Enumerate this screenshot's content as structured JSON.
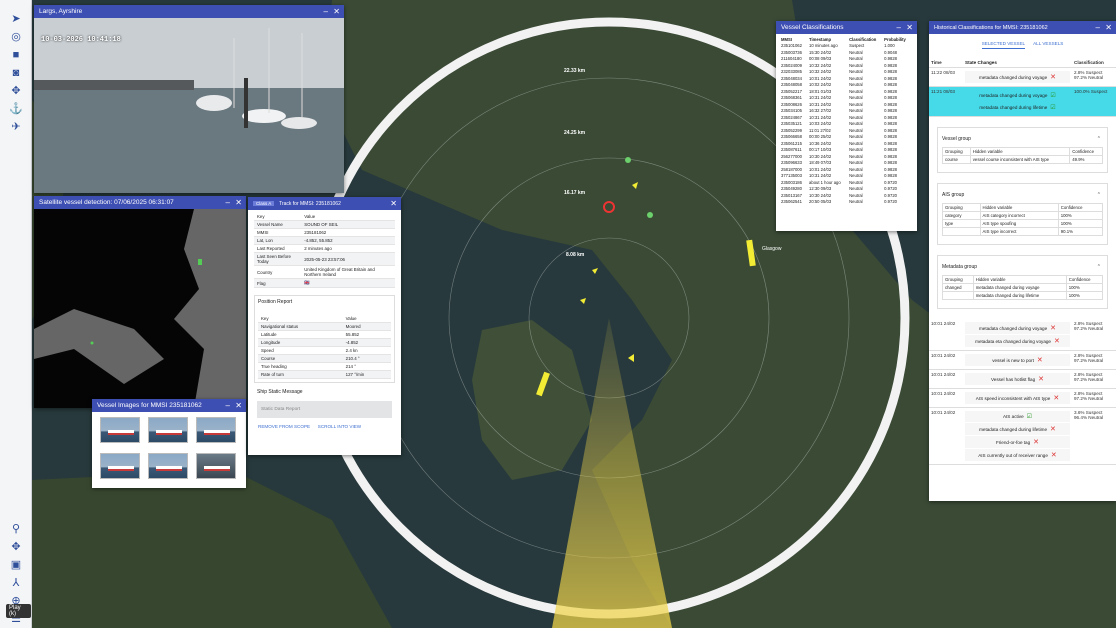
{
  "sidebar": {
    "tooltip": "Play (k)",
    "top_icons": [
      "navigation-icon",
      "radar-icon",
      "video-icon",
      "camera-icon",
      "satellite-icon",
      "anchor-icon",
      "satellite-dish-icon"
    ],
    "bottom_icons": [
      "pin-icon",
      "satellite-small-icon",
      "linkedin-icon",
      "route-icon",
      "zoom-icon",
      "list-icon"
    ]
  },
  "map": {
    "city_label": "Glasgow",
    "range_labels": [
      "22.33 km",
      "24.25 km",
      "16.17 km",
      "8.08 km"
    ],
    "ring_colors": {
      "sweep": "#f0d44a",
      "vessel": "#f0e13a",
      "ring": "#ffffff"
    }
  },
  "camera": {
    "title": "Largs, Ayrshire",
    "timestamp": "10-03-2026 10:41:18"
  },
  "satellite": {
    "title": "Satellite vessel detection: 07/06/2025 06:31:07"
  },
  "images": {
    "title": "Vessel Images for MMSI 235181062"
  },
  "track": {
    "badge": "Class A",
    "title": "Track for MMSI: 235181062",
    "head": {
      "key": "Key",
      "value": "Value"
    },
    "rows": [
      [
        "Vessel Name",
        "SOUND OF SEIL"
      ],
      [
        "MMSI",
        "235181062"
      ],
      [
        "Lat, Lon",
        "-4.852, 55.852"
      ],
      [
        "Last Reported",
        "2 minutes ago"
      ],
      [
        "Last Seen Before Today",
        "2025-05-23 23:57:06"
      ],
      [
        "Country",
        "United Kingdom of Great Britain and Northern Ireland"
      ],
      [
        "Flag",
        "🇬🇧"
      ]
    ],
    "position_title": "Position Report",
    "position_rows": [
      [
        "Navigational status",
        "Moored"
      ],
      [
        "Latitude",
        "55.852"
      ],
      [
        "Longitude",
        "-4.852"
      ],
      [
        "Speed",
        "2.4 kn"
      ],
      [
        "Course",
        "210.4 °"
      ],
      [
        "True heading",
        "214 °"
      ],
      [
        "Rate of turn",
        "127 °/min"
      ]
    ],
    "static_title": "Ship Static Message",
    "static_button": "Static Data Report",
    "remove": "REMOVE FROM SCOPE",
    "scroll": "SCROLL INTO VIEW"
  },
  "classifications": {
    "title": "Vessel Classifications",
    "headers": [
      "MMSI",
      "Timestamp",
      "Classification",
      "Probability"
    ],
    "rows": [
      [
        "235101062",
        "10 minutes ago",
        "Suspect",
        "1.000"
      ],
      [
        "235003736",
        "15:30 24/02",
        "Neutral",
        "0.9048"
      ],
      [
        "211604180",
        "00:08 09/03",
        "Neutral",
        "0.9828"
      ],
      [
        "235024009",
        "10:32 24/02",
        "Neutral",
        "0.9828"
      ],
      [
        "232033085",
        "10:32 24/02",
        "Neutral",
        "0.9828"
      ],
      [
        "235048034",
        "10:01 24/02",
        "Neutral",
        "0.9828"
      ],
      [
        "235048058",
        "10:02 24/02",
        "Neutral",
        "0.9828"
      ],
      [
        "235052217",
        "18:01 01/03",
        "Neutral",
        "0.9828"
      ],
      [
        "235068361",
        "10:31 24/02",
        "Neutral",
        "0.9828"
      ],
      [
        "235008626",
        "10:31 24/02",
        "Neutral",
        "0.9828"
      ],
      [
        "235034105",
        "16:32 27/02",
        "Neutral",
        "0.9828"
      ],
      [
        "235024867",
        "10:31 24/02",
        "Neutral",
        "0.9828"
      ],
      [
        "235035121",
        "10:03 24/02",
        "Neutral",
        "0.9828"
      ],
      [
        "235052299",
        "11:01 27/02",
        "Neutral",
        "0.9828"
      ],
      [
        "235066658",
        "00:00 25/02",
        "Neutral",
        "0.9828"
      ],
      [
        "235061215",
        "10:36 24/02",
        "Neutral",
        "0.9828"
      ],
      [
        "235087611",
        "00:17 10/03",
        "Neutral",
        "0.9828"
      ],
      [
        "256277000",
        "10:30 24/02",
        "Neutral",
        "0.9828"
      ],
      [
        "235096633",
        "18:49 07/03",
        "Neutral",
        "0.9828"
      ],
      [
        "258187000",
        "10:01 24/02",
        "Neutral",
        "0.9828"
      ],
      [
        "377135003",
        "10:31 24/02",
        "Neutral",
        "0.9828"
      ],
      [
        "235003186",
        "about 1 hour ago",
        "Neutral",
        "0.9720"
      ],
      [
        "235049280",
        "12:30 09/03",
        "Neutral",
        "0.9720"
      ],
      [
        "235013167",
        "10:30 24/02",
        "Neutral",
        "0.9720"
      ],
      [
        "235062541",
        "20:50 05/03",
        "Neutral",
        "0.9720"
      ]
    ]
  },
  "historical": {
    "title": "Historical Classifications for MMSI: 235181062",
    "tabs": [
      "SELECTED VESSEL",
      "ALL VESSELS"
    ],
    "headers": [
      "Time",
      "State Changes",
      "Classification"
    ],
    "top_rows": [
      {
        "time": "11:22 08/03",
        "changes": [
          {
            "text": "metadata changed during voyage",
            "mark": "x"
          }
        ],
        "cls": "2.8% Suspect 97.2% Neutral"
      },
      {
        "time": "11:21 08/03",
        "changes": [
          {
            "text": "metadata changed during voyage",
            "mark": "c"
          },
          {
            "text": "metadata changed during lifetime",
            "mark": "c"
          }
        ],
        "cls": "100.0% Suspect"
      }
    ],
    "groups": [
      {
        "title": "Vessel group",
        "head": [
          "Grouping",
          "Hidden variable",
          "Confidence"
        ],
        "rows": [
          [
            "course",
            "vessel course inconsistent with AIS type",
            "49.9%"
          ]
        ]
      },
      {
        "title": "AIS group",
        "head": [
          "Grouping",
          "Hidden variable",
          "Confidence"
        ],
        "rows": [
          [
            "category",
            "AIS category incorrect",
            "100%"
          ],
          [
            "type",
            "AIS type spoofing",
            "100%"
          ],
          [
            "",
            "AIS type incorrect",
            "90.1%"
          ]
        ]
      },
      {
        "title": "Metadata group",
        "head": [
          "Grouping",
          "Hidden variable",
          "Confidence"
        ],
        "rows": [
          [
            "changed",
            "metadata changed during voyage",
            "100%"
          ],
          [
            "",
            "metadata changed during lifetime",
            "100%"
          ]
        ]
      }
    ],
    "bottom_rows": [
      {
        "time": "10:01 24/02",
        "changes": [
          {
            "text": "metadata changed during voyage",
            "mark": "x"
          },
          {
            "text": "metadata eta changed during voyage",
            "mark": "x"
          }
        ],
        "cls": "2.8% Suspect 97.2% Neutral"
      },
      {
        "time": "10:01 24/02",
        "changes": [
          {
            "text": "vessel is new to port",
            "mark": "x"
          }
        ],
        "cls": "2.8% Suspect 97.2% Neutral"
      },
      {
        "time": "10:01 24/02",
        "changes": [
          {
            "text": "Vessel has hotlist flag",
            "mark": "x"
          }
        ],
        "cls": "2.8% Suspect 97.2% Neutral"
      },
      {
        "time": "10:01 24/02",
        "changes": [
          {
            "text": "AIS speed inconsistent with AIS type",
            "mark": "x"
          }
        ],
        "cls": "2.8% Suspect 97.2% Neutral"
      },
      {
        "time": "10:01 24/02",
        "changes": [
          {
            "text": "AIS active",
            "mark": "c"
          },
          {
            "text": "metadata changed during lifetime",
            "mark": "x"
          },
          {
            "text": "Friend-or-foe tag",
            "mark": "x"
          },
          {
            "text": "AIS currently out of receiver range",
            "mark": "x"
          }
        ],
        "cls": "3.6% Suspect 96.4% Neutral"
      }
    ]
  }
}
